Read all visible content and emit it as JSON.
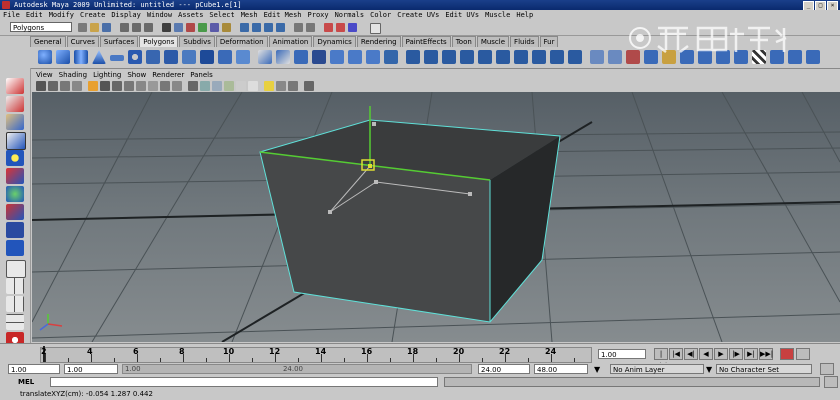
{
  "window": {
    "title": "Autodesk Maya 2009 Unlimited: untitled   ---   pCube1.e[1]",
    "controls": [
      "_",
      "□",
      "×"
    ]
  },
  "menubar": [
    "File",
    "Edit",
    "Modify",
    "Create",
    "Display",
    "Window",
    "Assets",
    "Select",
    "Mesh",
    "Edit Mesh",
    "Proxy",
    "Normals",
    "Color",
    "Create UVs",
    "Edit UVs",
    "Muscle",
    "Help"
  ],
  "status_line": {
    "mode": "Polygons"
  },
  "shelf_tabs": [
    "General",
    "Curves",
    "Surfaces",
    "Polygons",
    "Subdivs",
    "Deformation",
    "Animation",
    "Dynamics",
    "Rendering",
    "PaintEffects",
    "Toon",
    "Muscle",
    "Fluids",
    "Fur"
  ],
  "active_shelf_tab": "Polygons",
  "viewport_menu": [
    "View",
    "Shading",
    "Lighting",
    "Show",
    "Renderer",
    "Panels"
  ],
  "timeline": {
    "tick_labels": [
      "2",
      "4",
      "6",
      "8",
      "10",
      "12",
      "14",
      "16",
      "18",
      "20",
      "22",
      "24"
    ],
    "current_frame": "1.00",
    "playback_buttons": [
      "|◀◀",
      "|◀",
      "◀|",
      "◀",
      "▶",
      "|▶",
      "▶|",
      "▶▶|"
    ]
  },
  "range": {
    "start_time": "1.00",
    "playback_start": "1.00",
    "slider_left": "1.00",
    "slider_right": "24.00",
    "playback_end": "24.00",
    "end_time": "48.00",
    "anim_layer": "No Anim Layer",
    "character_set": "No Character Set"
  },
  "command_line": {
    "label": "MEL",
    "value": ""
  },
  "help_line": "translateXYZ(cm):  -0.054        1.287        0.442",
  "colors": {
    "title_blue": "#0a2a6e",
    "wire_highlight": "#5fe0d8",
    "selected_edge": "#55cc33",
    "manipulator": "#dddd33"
  }
}
